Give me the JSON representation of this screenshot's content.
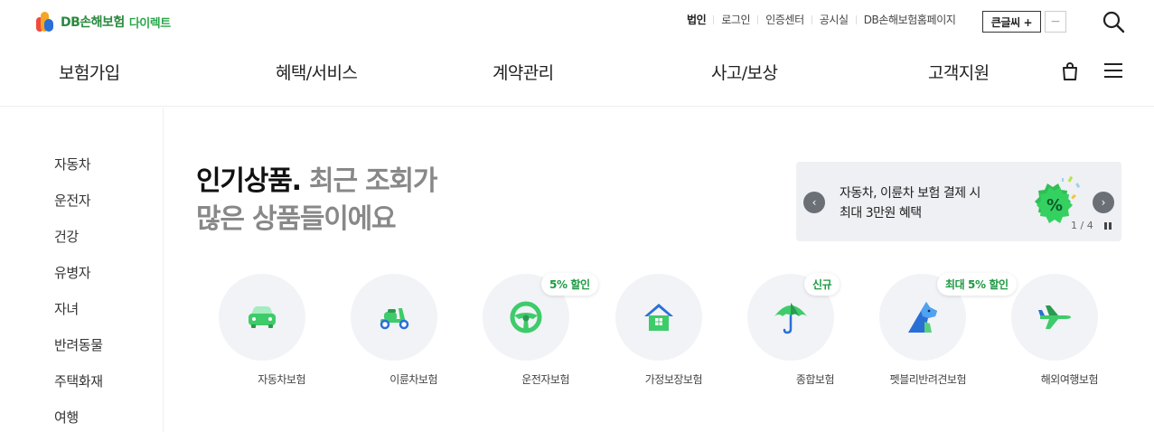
{
  "header": {
    "logo_text": "DB손해보험",
    "logo_sub": "다이렉트",
    "util_links": [
      "법인",
      "로그인",
      "인증센터",
      "공시실",
      "DB손해보험홈페이지"
    ],
    "bigtext_label": "큰글씨 +",
    "minus_label": "−"
  },
  "gnb": {
    "menus": [
      "보험가입",
      "혜택/서비스",
      "계약관리",
      "사고/보상",
      "고객지원"
    ]
  },
  "sidebar": {
    "items": [
      "자동차",
      "운전자",
      "건강",
      "유병자",
      "자녀",
      "반려동물",
      "주택화재",
      "여행"
    ]
  },
  "headline": {
    "strong": "인기상품.",
    "rest1": " 최근 조회가",
    "line2": "많은 상품들이에요"
  },
  "banner": {
    "line1": "자동차, 이륜차 보험 결제 시",
    "line2": "최대 3만원 혜택",
    "page": "1 / 4",
    "prev": "‹",
    "next": "›"
  },
  "products": [
    {
      "label": "자동차보험",
      "badge": "",
      "icon": "car-icon"
    },
    {
      "label": "이륜차보험",
      "badge": "",
      "icon": "scooter-icon"
    },
    {
      "label": "운전자보험",
      "badge": "5% 할인",
      "icon": "steering-wheel-icon"
    },
    {
      "label": "가정보장보험",
      "badge": "",
      "icon": "house-icon"
    },
    {
      "label": "종합보험",
      "badge": "신규",
      "icon": "umbrella-icon"
    },
    {
      "label": "펫블리반려견보험",
      "badge": "최대 5% 할인",
      "icon": "dog-icon"
    },
    {
      "label": "해외여행보험",
      "badge": "",
      "icon": "airplane-icon"
    }
  ],
  "colors": {
    "brand_green": "#2a8a3e",
    "icon_green": "#3ecb6a",
    "badge_green": "#1f9a44"
  }
}
